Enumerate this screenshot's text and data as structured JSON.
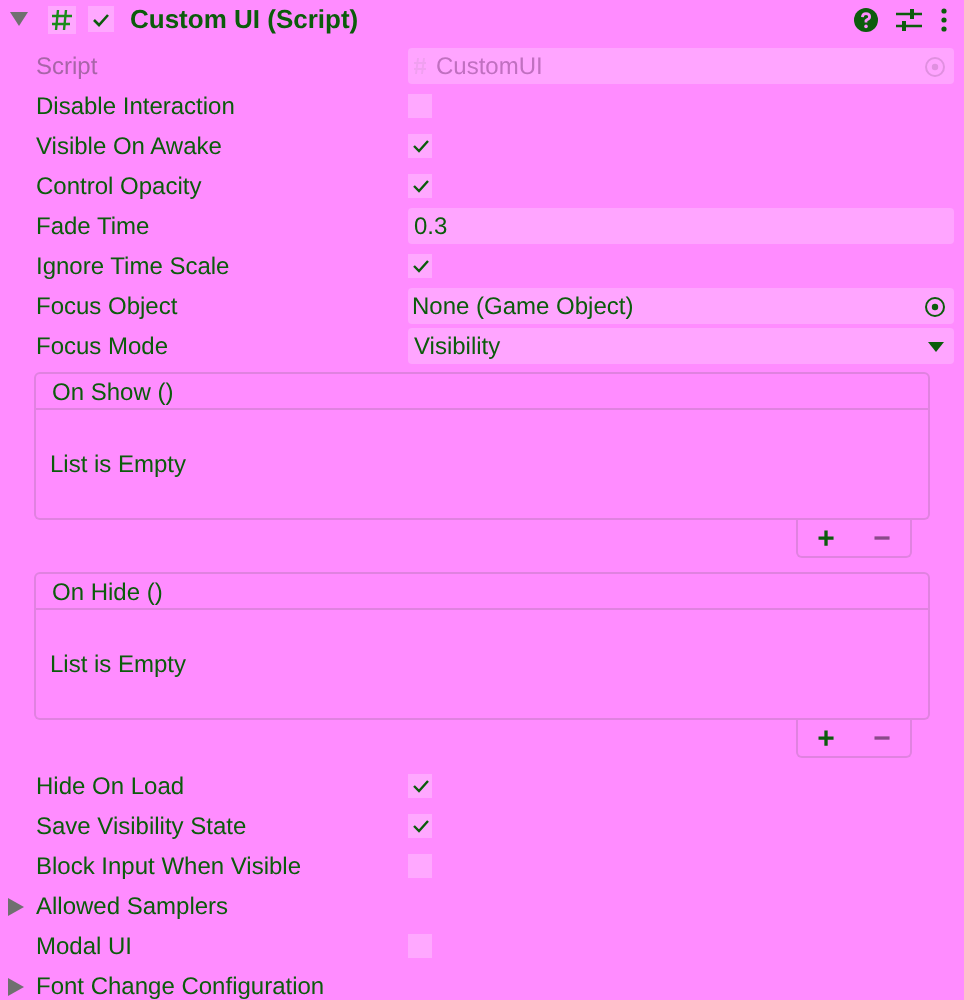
{
  "component": {
    "title": "Custom UI (Script)",
    "expanded": true,
    "enabled": true
  },
  "properties": [
    {
      "kind": "object",
      "label": "Script",
      "value": "CustomUI",
      "disabled": true
    },
    {
      "kind": "toggle",
      "label": "Disable Interaction",
      "checked": false
    },
    {
      "kind": "toggle",
      "label": "Visible On Awake",
      "checked": true
    },
    {
      "kind": "toggle",
      "label": "Control Opacity",
      "checked": true
    },
    {
      "kind": "float",
      "label": "Fade Time",
      "value": "0.3"
    },
    {
      "kind": "toggle",
      "label": "Ignore Time Scale",
      "checked": true
    },
    {
      "kind": "object",
      "label": "Focus Object",
      "value": "None (Game Object)"
    },
    {
      "kind": "enum",
      "label": "Focus Mode",
      "value": "Visibility"
    },
    {
      "kind": "event",
      "label": "On Show ()",
      "empty_text": "List is Empty",
      "add": "+",
      "remove": "−"
    },
    {
      "kind": "event",
      "label": "On Hide ()",
      "empty_text": "List is Empty",
      "add": "+",
      "remove": "−"
    },
    {
      "kind": "toggle",
      "label": "Hide On Load",
      "checked": true
    },
    {
      "kind": "toggle",
      "label": "Save Visibility State",
      "checked": true
    },
    {
      "kind": "toggle",
      "label": "Block Input When Visible",
      "checked": false
    },
    {
      "kind": "foldout",
      "label": "Allowed Samplers",
      "expanded": false
    },
    {
      "kind": "toggle",
      "label": "Modal UI",
      "checked": false
    },
    {
      "kind": "foldout",
      "label": "Font Change Configuration",
      "expanded": false
    }
  ]
}
